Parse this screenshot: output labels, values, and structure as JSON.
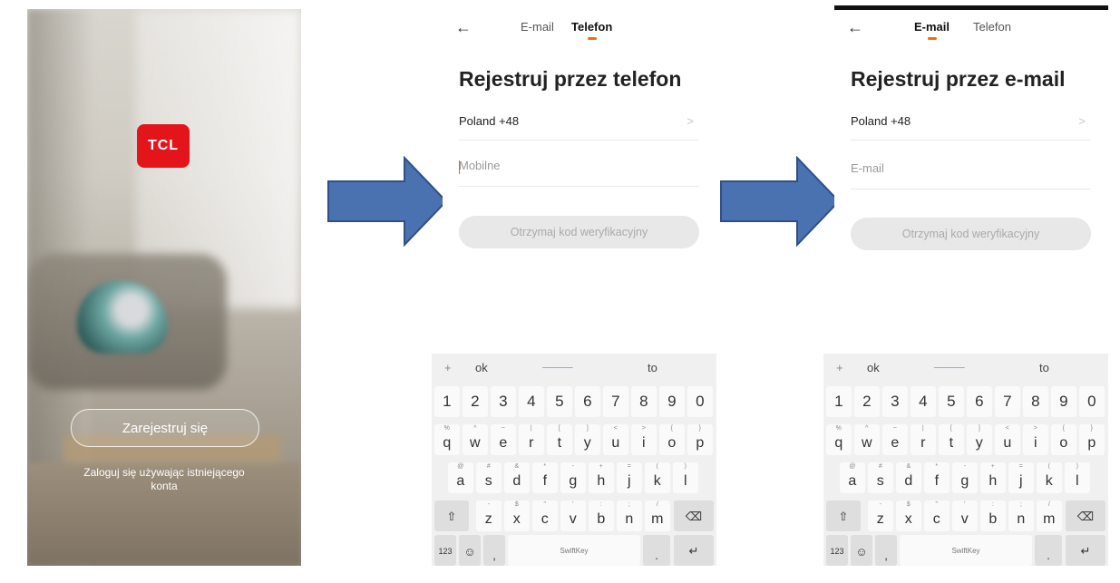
{
  "splash": {
    "logo": "TCL",
    "register_button": "Zarejestruj się",
    "login_link": "Zaloguj się używając istniejącego konta"
  },
  "phone_screen": {
    "back_icon": "arrow-left-icon",
    "tab_email": "E-mail",
    "tab_phone": "Telefon",
    "active_tab": "Telefon",
    "title": "Rejestruj przez telefon",
    "country": "Poland +48",
    "chevron": ">",
    "input_placeholder": "Mobilne",
    "code_button": "Otrzymaj kod weryfikacyjny"
  },
  "email_screen": {
    "back_icon": "arrow-left-icon",
    "tab_email": "E-mail",
    "tab_phone": "Telefon",
    "active_tab": "E-mail",
    "title": "Rejestruj przez e-mail",
    "country": "Poland +48",
    "chevron": ">",
    "input_placeholder": "E-mail",
    "code_button": "Otrzymaj kod weryfikacyjny"
  },
  "keyboard": {
    "suggestions": [
      "+",
      "ok",
      "to"
    ],
    "suggestion_link_color": "#5b8fd9",
    "numbers": [
      "1",
      "2",
      "3",
      "4",
      "5",
      "6",
      "7",
      "8",
      "9",
      "0"
    ],
    "row1": [
      [
        "q",
        "%"
      ],
      [
        "w",
        "^"
      ],
      [
        "e",
        "~"
      ],
      [
        "r",
        "|"
      ],
      [
        "t",
        "["
      ],
      [
        "y",
        "]"
      ],
      [
        "u",
        "<"
      ],
      [
        "i",
        ">"
      ],
      [
        "o",
        "{"
      ],
      [
        "p",
        "}"
      ]
    ],
    "row2": [
      [
        "a",
        "@"
      ],
      [
        "s",
        "#"
      ],
      [
        "d",
        "&"
      ],
      [
        "f",
        "*"
      ],
      [
        "g",
        "-"
      ],
      [
        "h",
        "+"
      ],
      [
        "j",
        "="
      ],
      [
        "k",
        "("
      ],
      [
        "l",
        ")"
      ]
    ],
    "row3": [
      [
        "z",
        "-"
      ],
      [
        "x",
        "$"
      ],
      [
        "c",
        "\""
      ],
      [
        "v",
        "'"
      ],
      [
        "b",
        ":"
      ],
      [
        "n",
        ";"
      ],
      [
        "m",
        "/"
      ]
    ],
    "shift_icon": "shift-icon",
    "backspace_icon": "backspace-icon",
    "mode_key": "123",
    "emoji_icon": "emoji-icon",
    "comma_key": ",",
    "space_label": "SwiftKey",
    "period_key": ".",
    "enter_icon": "enter-icon"
  },
  "colors": {
    "brand_red": "#e4141b",
    "tab_indicator": "#f26b10",
    "arrow_fill": "#4a72b0",
    "arrow_stroke": "#2f4f86"
  }
}
